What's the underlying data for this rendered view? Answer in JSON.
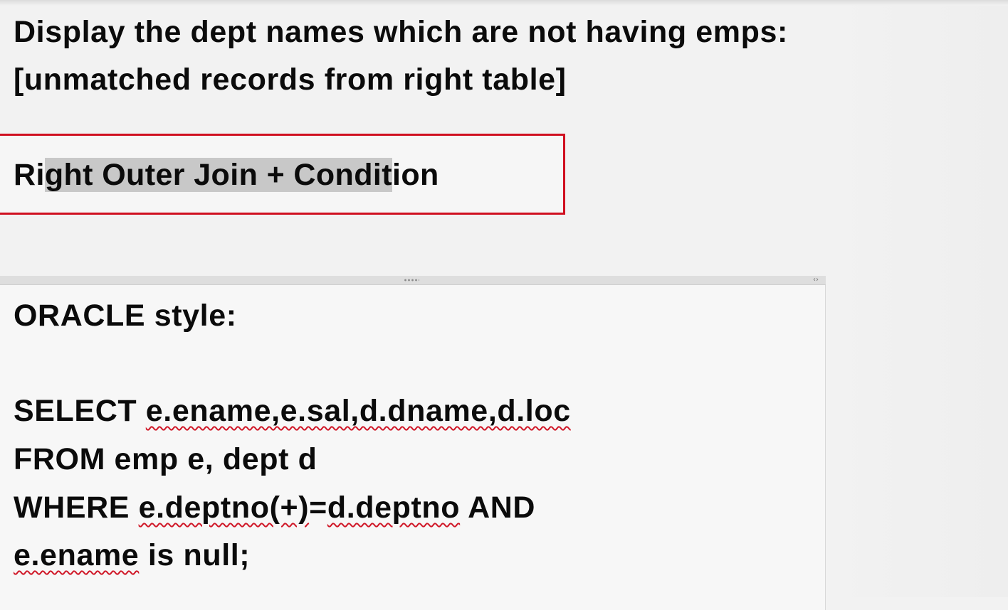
{
  "heading": {
    "line1": "Display the dept names which are not having emps:",
    "line2": "[unmatched records from right table]"
  },
  "callout": {
    "prefix": "Ri",
    "selected": "ght Outer Join + Condit",
    "suffix": "ion"
  },
  "code": {
    "style_label": "ORACLE style:",
    "select_keyword": "SELECT",
    "select_columns": "e.ename,e.sal,d.dname,d.loc",
    "from_line": "FROM emp e, dept d",
    "where_keyword": "WHERE",
    "where_left": "e.deptno(+)",
    "where_eq": "=",
    "where_right": "d.deptno",
    "where_and": "AND",
    "null_column": "e.ename",
    "null_rest": "is null;"
  },
  "colors": {
    "callout_border": "#d01020",
    "spell_check_underline": "#d01828",
    "selection_highlight": "#c8c8c8"
  },
  "icons": {
    "panel_grip": "grip-dots-icon",
    "panel_expand": "expand-arrows-icon"
  }
}
